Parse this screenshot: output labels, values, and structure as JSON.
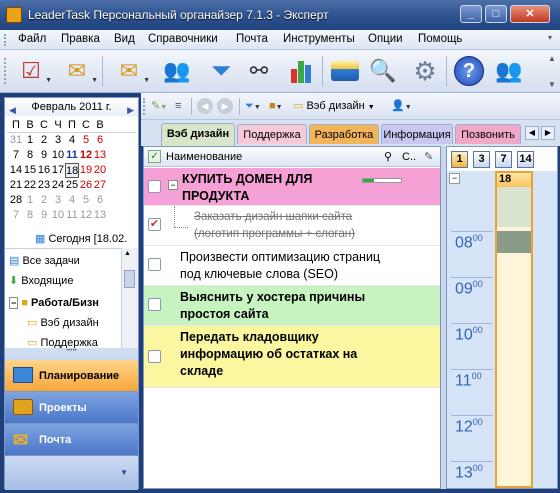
{
  "window": {
    "title": "LeaderTask Персональный органайзер 7.1.3 - Эксперт"
  },
  "menu": [
    "Файл",
    "Правка",
    "Вид",
    "Справочники",
    "Почта",
    "Инструменты",
    "Опции",
    "Помощь"
  ],
  "toolbar": {
    "buttons": [
      {
        "icon": "checklist-icon",
        "glyph": "☑",
        "color": "#c0392b"
      },
      {
        "icon": "envelope-icon",
        "glyph": "✉",
        "color": "#d69a1a"
      },
      {
        "icon": "mail-add-icon",
        "glyph": "✉",
        "color": "#d69a1a"
      },
      {
        "icon": "contacts-icon",
        "glyph": "👥",
        "color": "#b04a8a"
      },
      {
        "icon": "filter-icon",
        "glyph": "⏷",
        "color": "#2f7fd6"
      },
      {
        "icon": "binoculars-icon",
        "glyph": "⚯",
        "color": "#333333"
      },
      {
        "icon": "report-chart-icon",
        "glyph": "▮",
        "color": "#3aa845"
      },
      {
        "icon": "print-icon",
        "glyph": "▭",
        "color": "#2f7fd6"
      },
      {
        "icon": "print-preview-icon",
        "glyph": "🔍",
        "color": "#2f7fd6"
      },
      {
        "icon": "settings-gear-icon",
        "glyph": "⚙",
        "color": "#6b7f9a"
      },
      {
        "icon": "help-icon",
        "glyph": "?",
        "color": "#ffffff"
      },
      {
        "icon": "users-icon",
        "glyph": "👤",
        "color": "#b04a8a"
      }
    ]
  },
  "calendar": {
    "month_label": "Февраль 2011 г.",
    "weekdays": [
      "П",
      "В",
      "С",
      "Ч",
      "П",
      "С",
      "В"
    ],
    "weeks": [
      [
        "31",
        "1",
        "2",
        "3",
        "4",
        "5",
        "6"
      ],
      [
        "7",
        "8",
        "9",
        "10",
        "11",
        "12",
        "13"
      ],
      [
        "14",
        "15",
        "16",
        "17",
        "18",
        "19",
        "20"
      ],
      [
        "21",
        "22",
        "23",
        "24",
        "25",
        "26",
        "27"
      ],
      [
        "28",
        "1",
        "2",
        "3",
        "4",
        "5",
        "6"
      ],
      [
        "7",
        "8",
        "9",
        "10",
        "11",
        "12",
        "13"
      ]
    ],
    "today_label": "Сегодня [18.02."
  },
  "tree": {
    "items": [
      {
        "label": "Все задачи",
        "icon": "all-tasks-icon"
      },
      {
        "label": "Входящие",
        "icon": "inbox-icon"
      },
      {
        "label": "Работа/Бизн",
        "icon": "folder-icon"
      },
      {
        "label": "Вэб дизайн",
        "icon": "folder-icon"
      },
      {
        "label": "Поддержка",
        "icon": "folder-icon"
      }
    ]
  },
  "nav_panes": [
    {
      "label": "Планирование",
      "icon": "planning-icon"
    },
    {
      "label": "Проекты",
      "icon": "projects-briefcase-icon"
    },
    {
      "label": "Почта",
      "icon": "mail-icon"
    }
  ],
  "subtoolbar": {
    "project_label": "Вэб дизайн"
  },
  "tabs": [
    {
      "label": "Вэб дизайн",
      "color": "#d7e6c9",
      "active": true
    },
    {
      "label": "Поддержка",
      "color": "#f7c8d6"
    },
    {
      "label": "Разработка",
      "color": "#f3b45a"
    },
    {
      "label": "Информация",
      "color": "#c9c7ef"
    },
    {
      "label": "Позвонить",
      "color": "#f1a8c8"
    }
  ],
  "task_list": {
    "column_header": "Наименование",
    "col_c_label": "С..",
    "tasks": [
      {
        "text": "КУПИТЬ ДОМЕН ДЛЯ ПРОДУКТА",
        "bold": true,
        "bg": "#f6a1d6",
        "checked": false,
        "progress": 0.3
      },
      {
        "text": "Заказать дизайн шапки сайта (логотип программы + слоган)",
        "strike": true,
        "bg": "#ffffff",
        "checked": true
      },
      {
        "text": "Произвести оптимизацию страниц под ключевые слова (SEO)",
        "bg": "#ffffff",
        "checked": false
      },
      {
        "text": "Выяснить у хостера причины простоя сайта",
        "bold": true,
        "bg": "#c7f3c0",
        "checked": false
      },
      {
        "text": "Передать кладовщику информацию об остатках на складе",
        "bold": true,
        "bg": "#fbf6a0",
        "checked": false
      }
    ]
  },
  "day_view": {
    "view_buttons": [
      "1",
      "3",
      "7",
      "14"
    ],
    "day_number": "18",
    "hours": [
      {
        "h": "08",
        "m": "00"
      },
      {
        "h": "09",
        "m": "00"
      },
      {
        "h": "10",
        "m": "00"
      },
      {
        "h": "11",
        "m": "00"
      },
      {
        "h": "12",
        "m": "00"
      },
      {
        "h": "13",
        "m": "00"
      }
    ]
  }
}
